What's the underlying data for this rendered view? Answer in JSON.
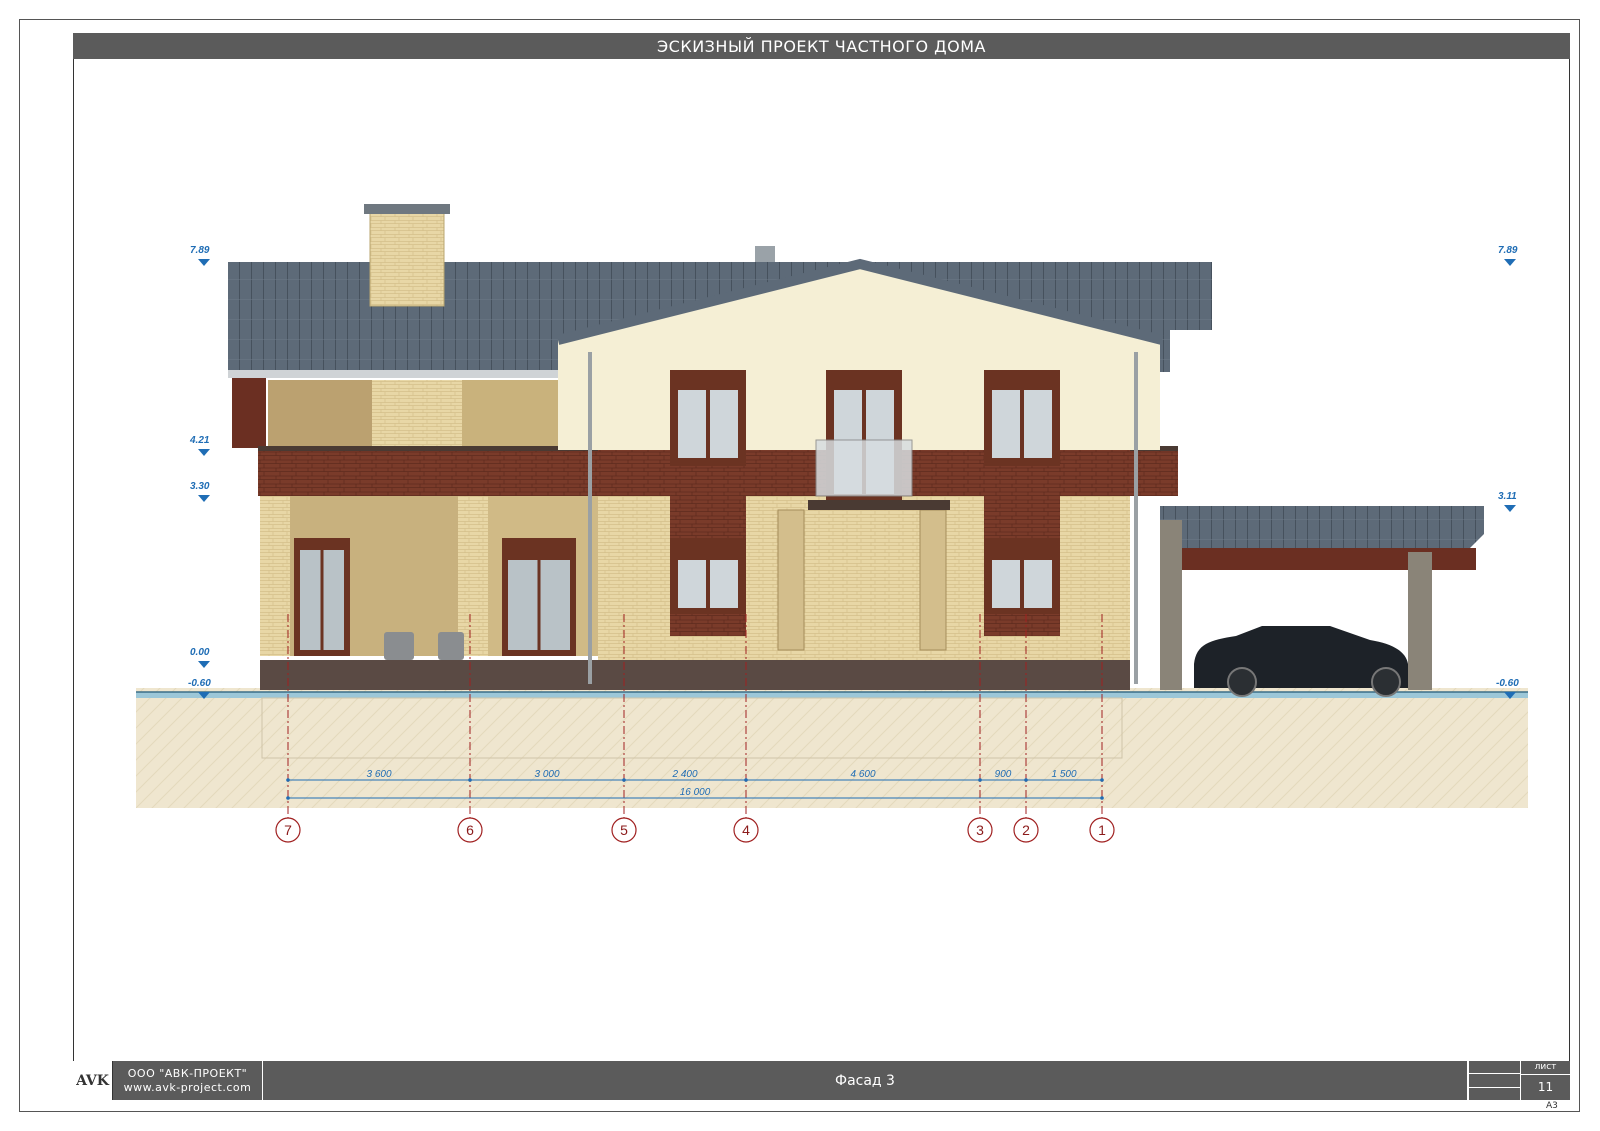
{
  "title": "ЭСКИЗНЫЙ ПРОЕКТ ЧАСТНОГО ДОМА",
  "footer": {
    "logo": "AVK",
    "company": "ООО \"АВК-ПРОЕКТ\"",
    "website": "www.avk-project.com",
    "sheet_name": "Фасад 3",
    "sheet_label": "лист",
    "sheet_number": "11",
    "format": "А3"
  },
  "levels": {
    "left_top": "7.89",
    "left_eave": "4.21",
    "left_floor2": "3.30",
    "left_zero": "0.00",
    "left_ground": "-0.60",
    "right_top": "7.89",
    "right_canopy": "3.11",
    "right_ground": "-0.60"
  },
  "dimensions": {
    "segments": [
      "3 600",
      "3 000",
      "2 400",
      "4 600",
      "900",
      "1 500"
    ],
    "total": "16 000"
  },
  "axes": [
    "7",
    "6",
    "5",
    "4",
    "3",
    "2",
    "1"
  ],
  "colors": {
    "roof": "#5d6a78",
    "brick_light": "#e8d7a6",
    "brick_dark": "#7a3b2a",
    "plaster": "#f5efd5",
    "plinth": "#5a4a44",
    "ground": "#efe6cf",
    "level_blue": "#1f6db5",
    "axis_red": "#8b1a1a",
    "title_bar": "#5b5b5b"
  }
}
